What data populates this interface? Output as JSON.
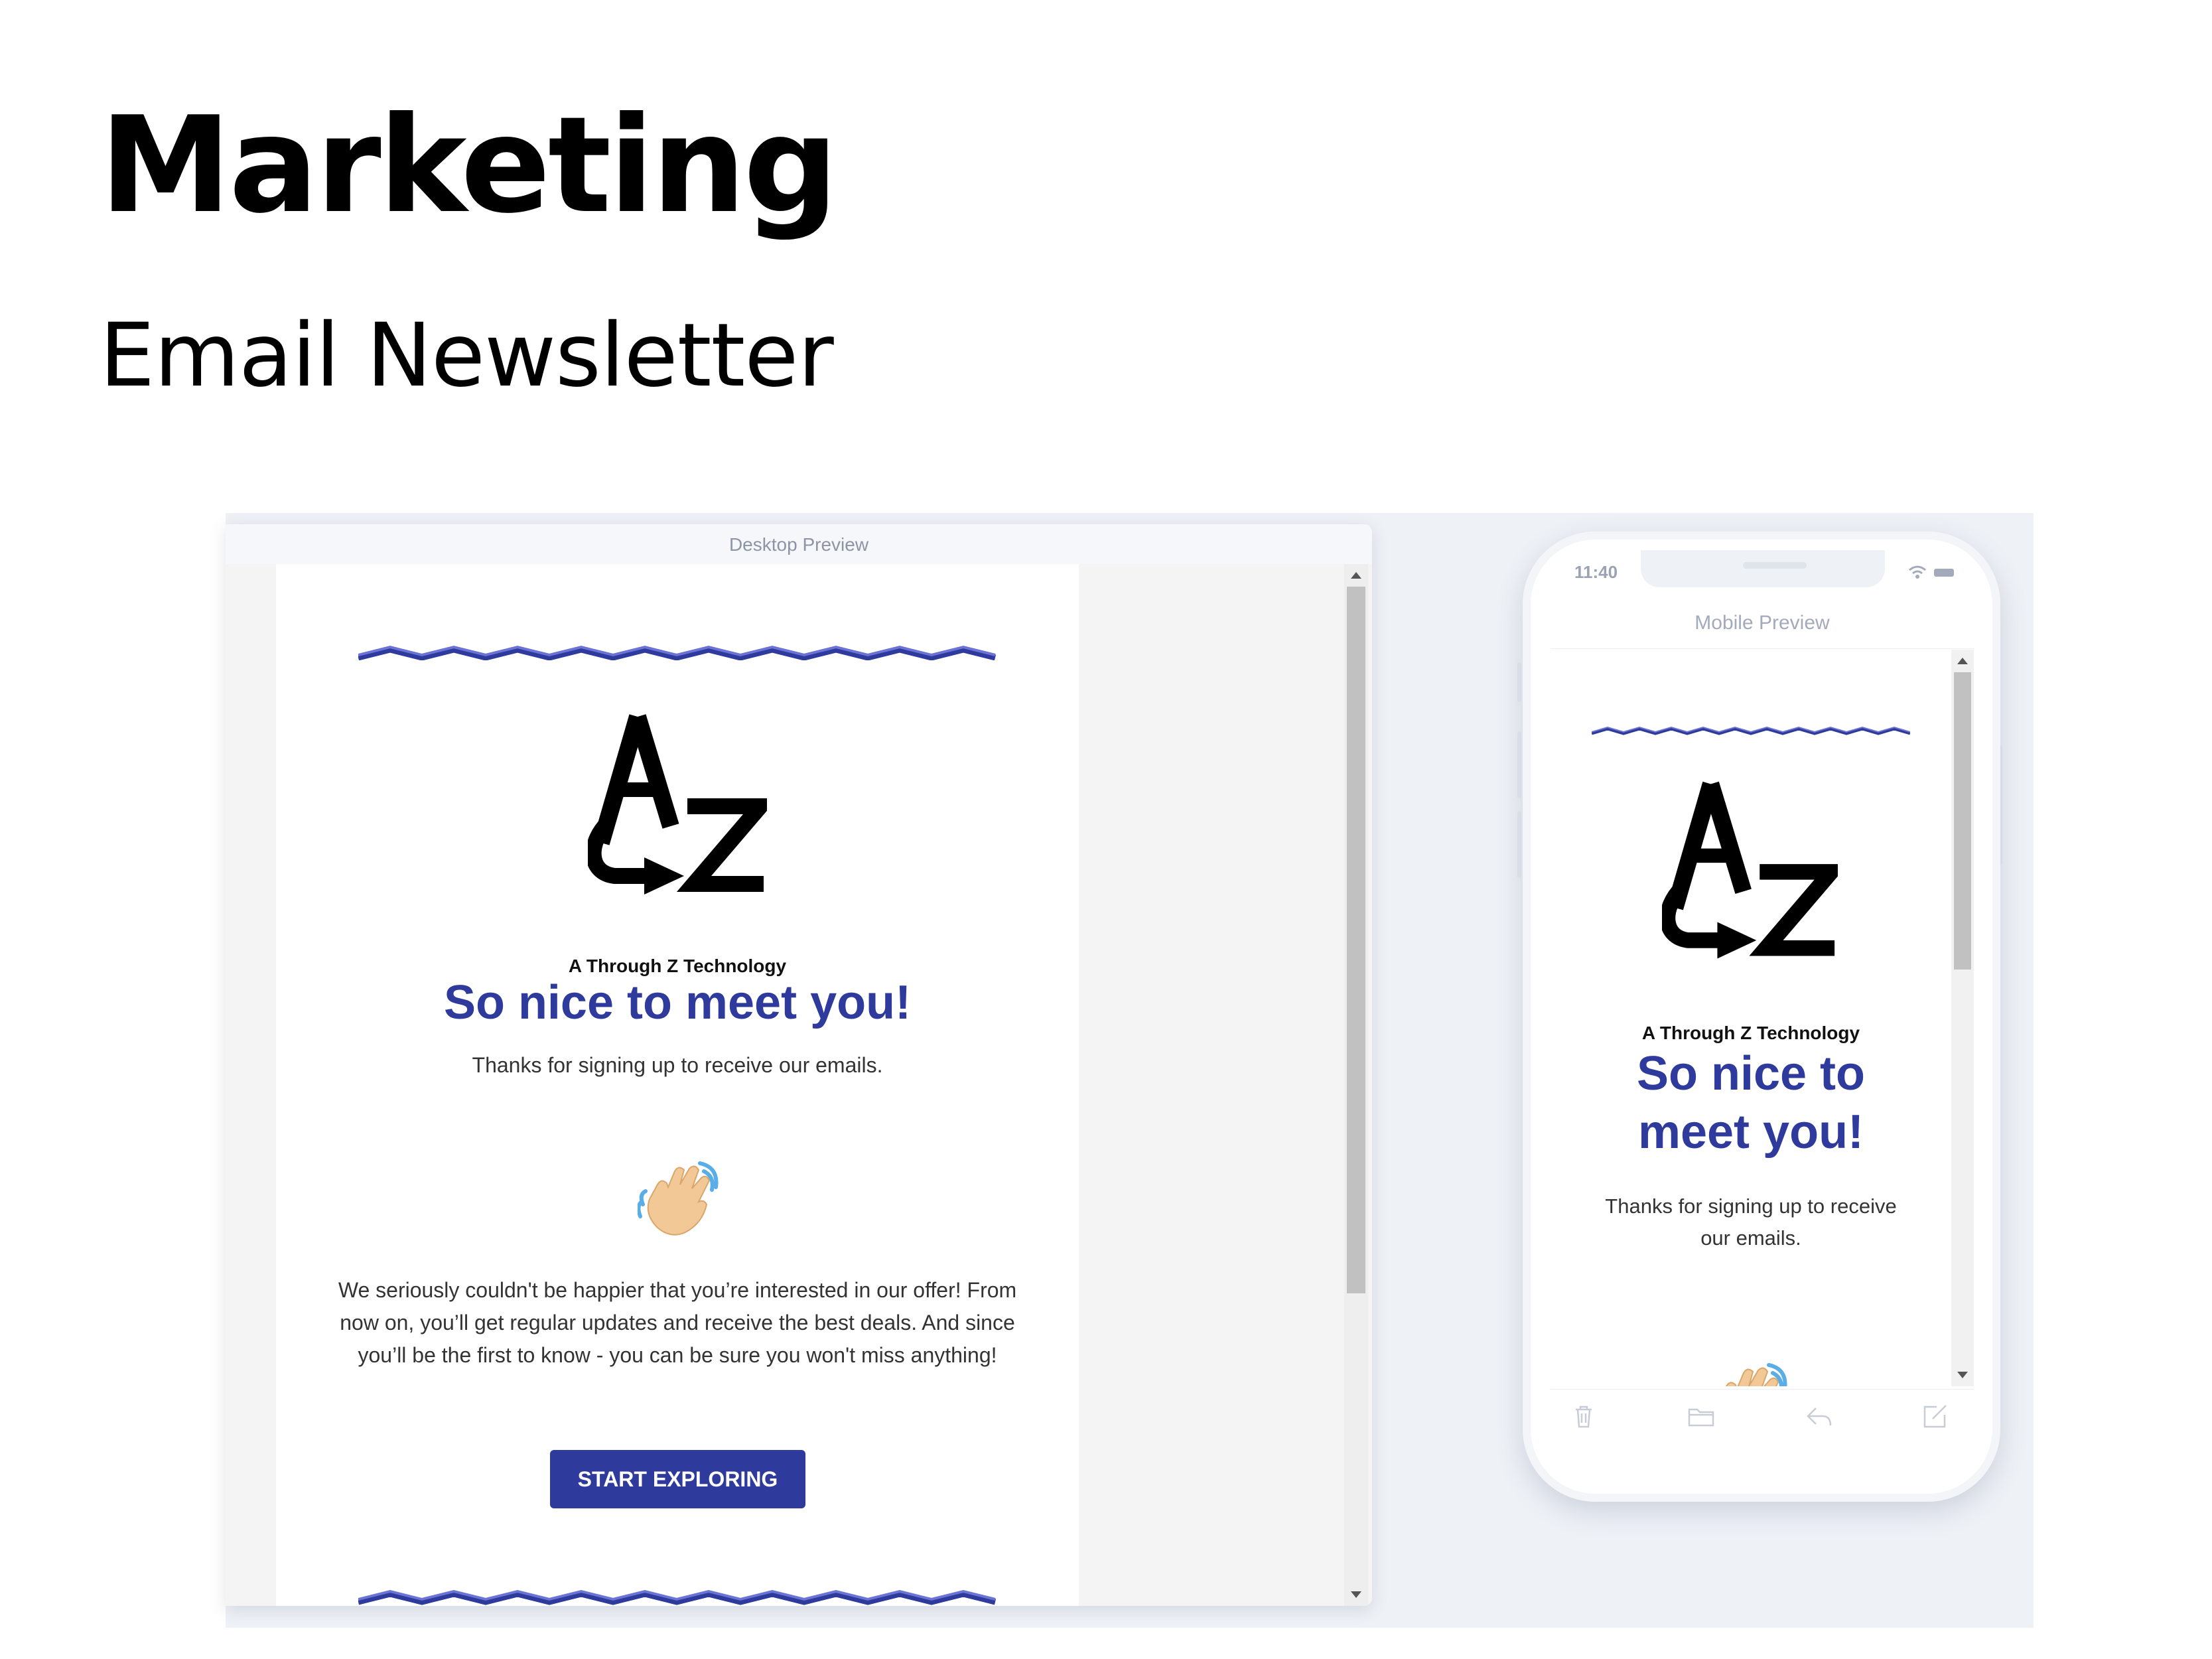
{
  "page": {
    "title": "Marketing",
    "subtitle": "Email Newsletter"
  },
  "desktop": {
    "label": "Desktop Preview"
  },
  "mobile": {
    "label": "Mobile Preview",
    "time": "11:40"
  },
  "email": {
    "brand": "A Through Z Technology",
    "headline": "So nice to meet you!",
    "headline_mobile_line1": "So nice to",
    "headline_mobile_line2": "meet you!",
    "intro": "Thanks for signing up to receive our emails.",
    "intro_mobile_line1": "Thanks for signing up to receive",
    "intro_mobile_line2": "our emails.",
    "body_line1": "We seriously couldn't be happier that you’re interested in our offer! From",
    "body_line2": "now on, you’ll get regular updates and receive the best deals. And since",
    "body_line3": "you’ll be the first to know - you can be sure you won't miss anything!",
    "cta_label": "START EXPLORING"
  },
  "colors": {
    "accent": "#2e3a9c",
    "wave_light": "#6b74d6",
    "stage": "#eef1f6"
  },
  "icons": [
    "waving-hand-icon",
    "trash-icon",
    "folder-icon",
    "reply-icon",
    "compose-icon",
    "wifi-icon",
    "battery-icon"
  ]
}
